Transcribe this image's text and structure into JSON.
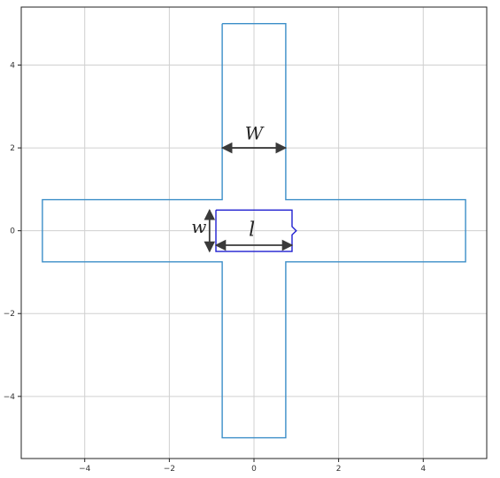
{
  "chart_data": {
    "type": "line",
    "title": "",
    "xlabel": "",
    "ylabel": "",
    "xlim": [
      -5.5,
      5.5
    ],
    "ylim": [
      -5.5,
      5.4
    ],
    "grid": true,
    "x_ticks": [
      -4,
      -2,
      0,
      2,
      4
    ],
    "y_ticks": [
      4,
      2,
      0,
      -2,
      -4
    ],
    "x_tick_labels": [
      "−4",
      "−2",
      "0",
      "2",
      "4"
    ],
    "y_tick_labels": [
      "4",
      "2",
      "0",
      "−2",
      "−4"
    ],
    "colors": {
      "cross": "#3b8ec8",
      "rect": "#1f1fd0",
      "arrow": "#3a3a3a",
      "grid": "#d0d0d0"
    },
    "series": [
      {
        "points": [
          [
            -0.75,
            5
          ],
          [
            0.75,
            5
          ],
          [
            0.75,
            0.75
          ],
          [
            5,
            0.75
          ],
          [
            5,
            -0.75
          ],
          [
            0.75,
            -0.75
          ],
          [
            0.75,
            -5
          ],
          [
            -0.75,
            -5
          ],
          [
            -0.75,
            -0.75
          ],
          [
            -5,
            -0.75
          ],
          [
            -5,
            0.75
          ],
          [
            -0.75,
            0.75
          ],
          [
            -0.75,
            5
          ]
        ]
      },
      {
        "points": [
          [
            -0.9,
            0.5
          ],
          [
            0.9,
            0.5
          ],
          [
            0.9,
            0.1
          ],
          [
            1.0,
            0
          ],
          [
            0.9,
            -0.1
          ],
          [
            0.9,
            -0.5
          ],
          [
            -0.9,
            -0.5
          ],
          [
            -0.9,
            0.5
          ]
        ]
      }
    ],
    "annotations": [
      {
        "text": "W",
        "x": 0,
        "y": 2.2,
        "arrow": {
          "from": [
            -0.75,
            2
          ],
          "to": [
            0.75,
            2
          ]
        }
      },
      {
        "text": "w",
        "x": -1.3,
        "y": -0.05,
        "arrow": {
          "from": [
            -1.05,
            0.5
          ],
          "to": [
            -1.05,
            -0.5
          ]
        }
      },
      {
        "text": "l",
        "x": -0.05,
        "y": -0.12,
        "arrow": {
          "from": [
            -0.9,
            -0.35
          ],
          "to": [
            0.9,
            -0.35
          ]
        }
      }
    ]
  }
}
